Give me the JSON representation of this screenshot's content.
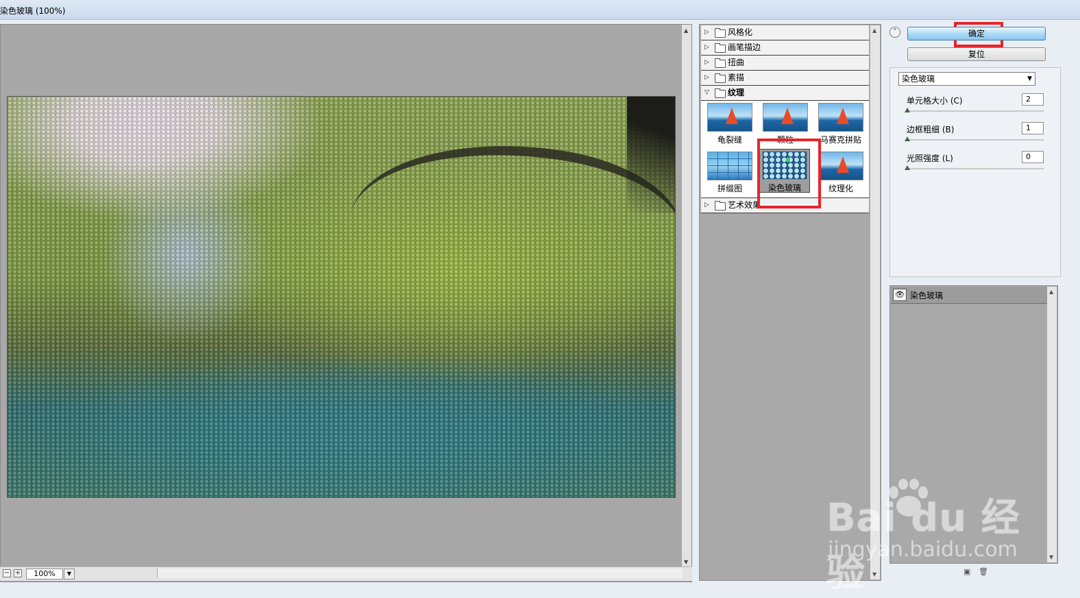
{
  "window": {
    "title": "染色玻璃 (100%)"
  },
  "preview": {
    "zoom_value": "100%"
  },
  "gallery": {
    "categories": [
      {
        "label": "风格化",
        "state": "collapsed"
      },
      {
        "label": "画笔描边",
        "state": "collapsed"
      },
      {
        "label": "扭曲",
        "state": "collapsed"
      },
      {
        "label": "素描",
        "state": "collapsed"
      },
      {
        "label": "纹理",
        "state": "expanded"
      },
      {
        "label": "艺术效果",
        "state": "collapsed"
      }
    ],
    "texture_filters": [
      {
        "label": "龟裂缝",
        "icon": "craquelure-thumbnail"
      },
      {
        "label": "颗粒",
        "icon": "grain-thumbnail"
      },
      {
        "label": "马赛克拼贴",
        "icon": "mosaic-tiles-thumbnail"
      },
      {
        "label": "拼缀图",
        "icon": "patchwork-thumbnail"
      },
      {
        "label": "染色玻璃",
        "icon": "stained-glass-thumbnail",
        "selected": true
      },
      {
        "label": "纹理化",
        "icon": "texturizer-thumbnail"
      }
    ]
  },
  "buttons": {
    "ok": "确定",
    "reset": "复位"
  },
  "settings": {
    "filter_select": "染色玻璃",
    "params": [
      {
        "label": "单元格大小 (C)",
        "value": "2"
      },
      {
        "label": "边框粗细 (B)",
        "value": "1"
      },
      {
        "label": "光照强度 (L)",
        "value": "0"
      }
    ]
  },
  "layers": {
    "items": [
      {
        "label": "染色玻璃",
        "visible": true
      }
    ]
  },
  "watermark": {
    "brand": "Bai du 经验",
    "url": "jingyan.baidu.com"
  },
  "colors": {
    "highlight_box": "#e8242b",
    "ok_button": "#a9d8f7"
  }
}
